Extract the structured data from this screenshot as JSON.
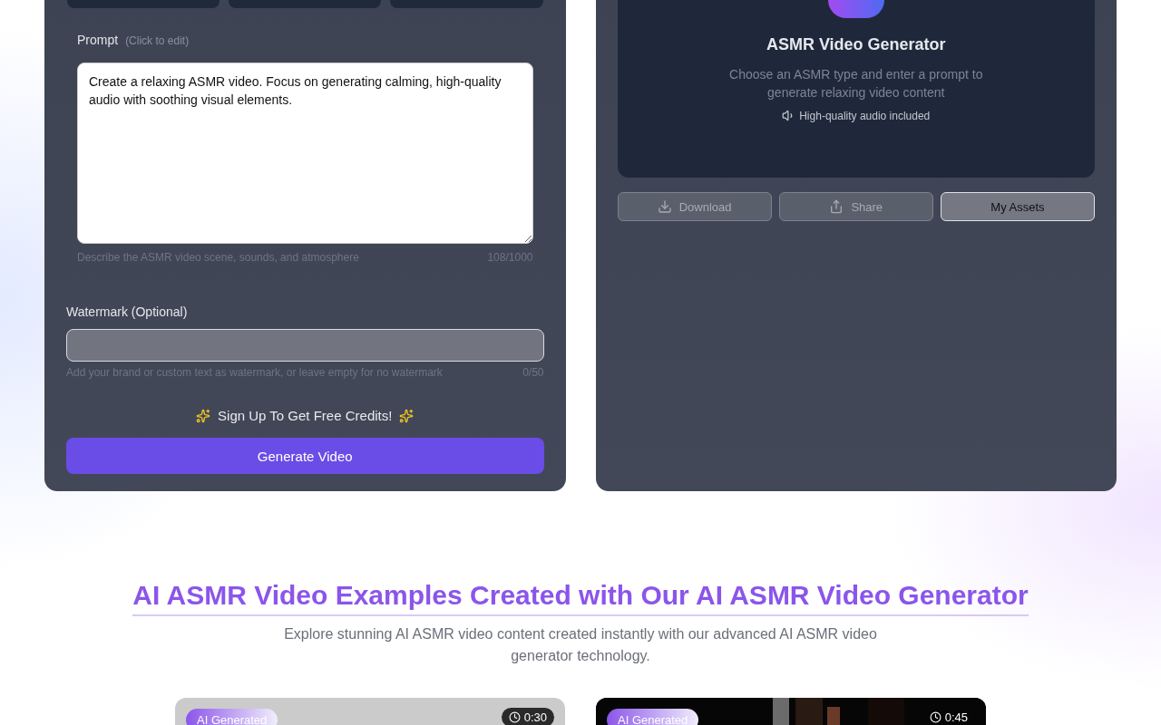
{
  "form": {
    "type_options": [
      {
        "kind": "option"
      },
      {
        "kind": "option"
      },
      {
        "kind": "option"
      }
    ],
    "prompt": {
      "label": "Prompt",
      "hint": "(Click to edit)",
      "value": "Create a relaxing ASMR video. Focus on generating calming, high-quality audio with soothing visual elements.",
      "help": "Describe the ASMR video scene, sounds, and atmosphere",
      "count": "108/1000"
    },
    "watermark": {
      "label": "Watermark (Optional)",
      "help": "Add your brand or custom text as watermark, or leave empty for no watermark",
      "count": "0/50"
    },
    "promo": "Sign Up To Get Free Credits!",
    "submit": "Generate Video"
  },
  "preview": {
    "title": "ASMR Video Generator",
    "description": "Choose an ASMR type and enter a prompt to generate relaxing video content",
    "note": "High-quality audio included",
    "actions": [
      {
        "label": "Download",
        "kind": "download",
        "disabled": true
      },
      {
        "label": "Share",
        "kind": "share",
        "disabled": true
      },
      {
        "label": "My Assets",
        "kind": "plain",
        "disabled": false
      }
    ]
  },
  "examples": {
    "title": "AI ASMR Video Examples Created with Our AI ASMR Video Generator",
    "subtitle": "Explore stunning AI ASMR video content created instantly with our advanced AI ASMR video generator technology.",
    "cards": [
      {
        "badge": "AI Generated",
        "duration": "0:30",
        "kind": "blank"
      },
      {
        "badge": "AI Generated",
        "duration": "0:45",
        "kind": "picture"
      }
    ]
  }
}
